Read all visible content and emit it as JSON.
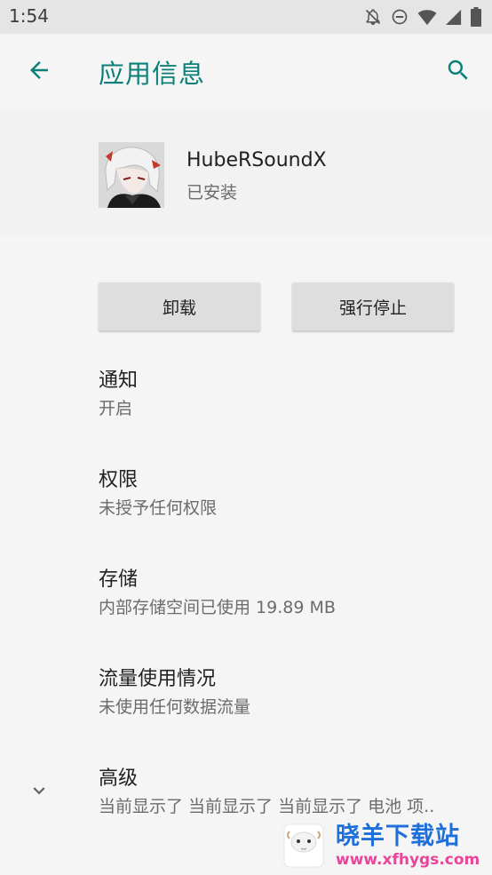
{
  "status_bar": {
    "time": "1:54",
    "icons": [
      "notifications-off-icon",
      "do-not-disturb-icon",
      "wifi-icon",
      "signal-icon",
      "battery-icon"
    ]
  },
  "app_bar": {
    "title": "应用信息",
    "back_icon": "arrow-back-icon",
    "search_icon": "search-icon"
  },
  "app_header": {
    "name": "HubeRSoundX",
    "status": "已安装"
  },
  "buttons": {
    "uninstall": "卸载",
    "force_stop": "强行停止"
  },
  "preferences": [
    {
      "title": "通知",
      "summary": "开启"
    },
    {
      "title": "权限",
      "summary": "未授予任何权限"
    },
    {
      "title": "存储",
      "summary": "内部存储空间已使用 19.89 MB"
    },
    {
      "title": "流量使用情况",
      "summary": "未使用任何数据流量"
    },
    {
      "title": "高级",
      "summary": "当前显示了 当前显示了 当前显示了 电池 项.."
    }
  ],
  "watermark": {
    "name": "晓羊下载站",
    "url": "www.xfhygs.com"
  },
  "colors": {
    "accent": "#0b8079",
    "statusbar": "#e5e5e5",
    "background": "#f5f5f5",
    "button": "#dedede",
    "watermark_blue": "#1e6fd9",
    "watermark_pink": "#e8459a"
  }
}
